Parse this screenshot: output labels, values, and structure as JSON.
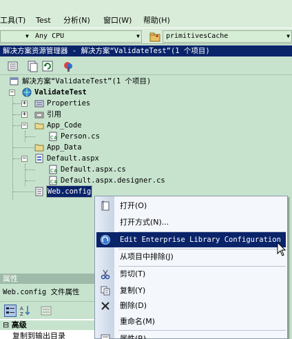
{
  "menubar": {
    "items": [
      "工具(T)",
      "Test",
      "分析(N)",
      "窗口(W)",
      "帮助(H)"
    ]
  },
  "toolbar": {
    "platform_combo": "Any CPU",
    "startup_combo": "primitivesCache"
  },
  "solution_explorer": {
    "title": "解决方案资源管理器 - 解决方案“ValidateTest”(1 个项目)",
    "tree": {
      "solution": "解决方案“ValidateTest”(1 个项目)",
      "project": "ValidateTest",
      "properties": "Properties",
      "references": "引用",
      "app_code": "App_Code",
      "person": "Person.cs",
      "app_data": "App_Data",
      "default_aspx": "Default.aspx",
      "default_cs": "Default.aspx.cs",
      "default_designer": "Default.aspx.designer.cs",
      "web_config": "Web.config"
    }
  },
  "properties": {
    "title": "属性",
    "subject": "Web.config 文件属性",
    "category": "高级",
    "row": "复制到输出目录"
  },
  "context_menu": {
    "open": "打开(O)",
    "open_with": "打开方式(N)...",
    "edit_entlib": "Edit Enterprise Library Configuration",
    "exclude": "从项目中排除(J)",
    "cut": "剪切(T)",
    "copy": "复制(Y)",
    "delete": "删除(D)",
    "rename": "重命名(M)",
    "properties": "属性(R)"
  },
  "colors": {
    "selection": "#0A246A",
    "background": "#C7E3CE",
    "menu_bg": "#F4F7FC"
  }
}
